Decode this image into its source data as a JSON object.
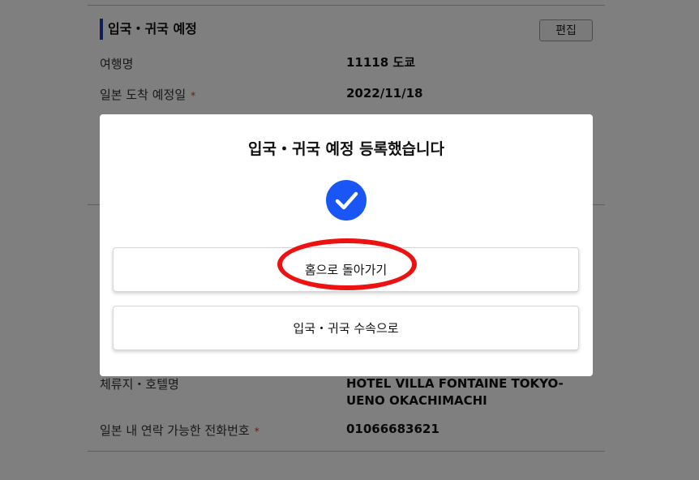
{
  "section": {
    "title": "입국・귀국 예정",
    "edit_label": "편집"
  },
  "rows": [
    {
      "label": "여행명",
      "required": false,
      "value": "11118 도쿄"
    },
    {
      "label": "일본 도착 예정일",
      "required": true,
      "value": "2022/11/18"
    },
    {
      "label": "체류지・호텔명",
      "required": false,
      "value": "HOTEL VILLA FONTAINE TOKYO-UENO OKACHIMACHI"
    },
    {
      "label": "일본 내 연락 가능한 전화번호",
      "required": true,
      "value": "01066683621"
    }
  ],
  "required_mark": "*",
  "modal": {
    "title": "입국・귀국 예정 등록했습니다",
    "home_button": "홈으로 돌아가기",
    "procedure_button": "입국・귀국 수속으로"
  },
  "icons": {
    "success": "check-circle-icon"
  },
  "colors": {
    "accent": "#1a56f5",
    "section_bar": "#1d3fb0",
    "required": "#c0392b",
    "annotation": "#ee1111"
  }
}
